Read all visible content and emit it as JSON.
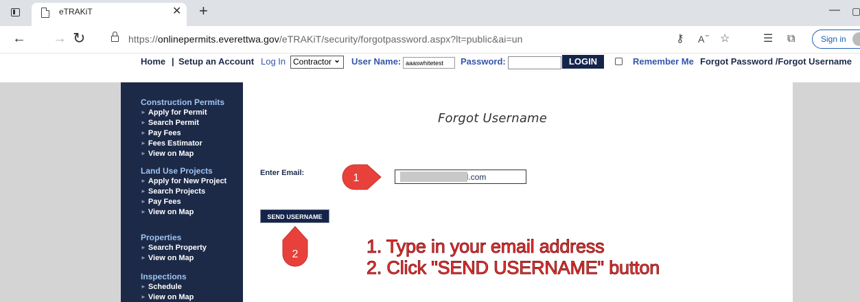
{
  "browser": {
    "tab_title": "eTRAKiT",
    "url_prefix": "https://",
    "url_host": "onlinepermits.everettwa.gov",
    "url_path": "/eTRAKiT/security/forgotpassword.aspx?lt=public&ai=un",
    "sign_in_label": "Sign in",
    "icons": [
      "tab-actions-icon",
      "page-icon",
      "close-icon",
      "plus-icon",
      "minimize-icon",
      "restore-icon",
      "back-icon",
      "forward-icon",
      "reload-icon",
      "lock-icon",
      "key-icon",
      "read-aloud-icon",
      "add-favorite-icon",
      "favorites-icon",
      "collections-icon",
      "profile-avatar-icon"
    ]
  },
  "site_nav": {
    "home": "Home",
    "separator": "|",
    "setup_account": "Setup an Account",
    "log_in": "Log In",
    "role_selected": "Contractor",
    "user_name_label": "User Name:",
    "user_name_value": "aaaswhitetest",
    "password_label": "Password:",
    "password_value": "",
    "login_button": "LOGIN",
    "remember_me": "Remember Me",
    "forgot_link": "Forgot Password /Forgot Username"
  },
  "sidebar": {
    "groups": [
      {
        "heading": "Construction Permits",
        "items": [
          "Apply for Permit",
          "Search Permit",
          "Pay Fees",
          "Fees Estimator",
          "View on Map"
        ]
      },
      {
        "heading": "Land Use Projects",
        "items": [
          "Apply for New Project",
          "Search Projects",
          "Pay Fees",
          "View on Map"
        ]
      },
      {
        "heading": "Properties",
        "items": [
          "Search Property",
          "View on Map"
        ]
      },
      {
        "heading": "Inspections",
        "items": [
          "Schedule",
          "View on Map"
        ]
      }
    ]
  },
  "form": {
    "title": "Forgot Username",
    "email_label": "Enter Email:",
    "email_value_visible": "il.com",
    "send_button": "SEND USERNAME"
  },
  "annotations": {
    "marker_1": "1",
    "marker_2": "2",
    "line_1": "1. Type in your email address",
    "line_2": "2. Click \"SEND USERNAME\" button",
    "marker_color": "#e8413c"
  }
}
